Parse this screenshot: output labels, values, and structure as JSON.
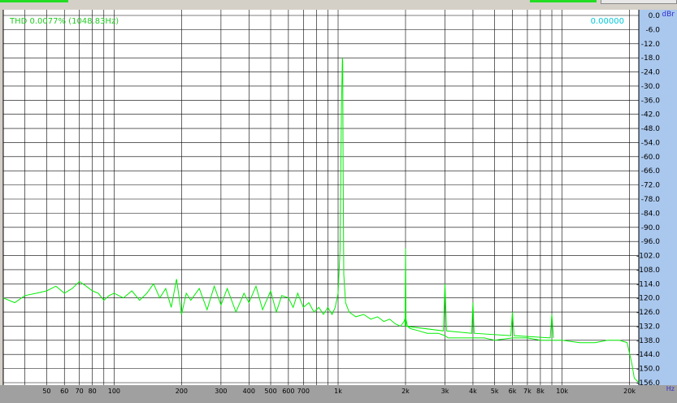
{
  "header": {
    "thd_label": "THD 0.0077% (1048.83Hz)",
    "value_readout": "0.00000",
    "unit_db": "dBr",
    "unit_hz": "Hz"
  },
  "colors": {
    "plot_bg": "#ffffff",
    "grid": "#000000",
    "trace": "#00ee00",
    "thd_text": "#22cc22",
    "readout_text": "#00c8d8",
    "y_axis_bg": "#aac8ee",
    "x_axis_bg": "#a0a0a0",
    "unit_text": "#3030d0"
  },
  "chart_data": {
    "type": "line",
    "xscale": "log",
    "xlim": [
      32,
      22000
    ],
    "ylim": [
      -156,
      0
    ],
    "x_tick_labels": [
      {
        "v": 50,
        "t": "50"
      },
      {
        "v": 60,
        "t": "60"
      },
      {
        "v": 70,
        "t": "70"
      },
      {
        "v": 80,
        "t": "80"
      },
      {
        "v": 100,
        "t": "100"
      },
      {
        "v": 200,
        "t": "200"
      },
      {
        "v": 300,
        "t": "300"
      },
      {
        "v": 400,
        "t": "400"
      },
      {
        "v": 500,
        "t": "500"
      },
      {
        "v": 600,
        "t": "600"
      },
      {
        "v": 700,
        "t": "700"
      },
      {
        "v": 1000,
        "t": "1k"
      },
      {
        "v": 2000,
        "t": "2k"
      },
      {
        "v": 3000,
        "t": "3k"
      },
      {
        "v": 4000,
        "t": "4k"
      },
      {
        "v": 5000,
        "t": "5k"
      },
      {
        "v": 6000,
        "t": "6k"
      },
      {
        "v": 7000,
        "t": "7k"
      },
      {
        "v": 8000,
        "t": "8k"
      },
      {
        "v": 10000,
        "t": "10k"
      },
      {
        "v": 20000,
        "t": "20k"
      }
    ],
    "x_grid": [
      40,
      50,
      60,
      70,
      80,
      90,
      100,
      200,
      300,
      400,
      500,
      600,
      700,
      800,
      900,
      1000,
      2000,
      3000,
      4000,
      5000,
      6000,
      7000,
      8000,
      9000,
      10000,
      20000
    ],
    "y_tick_labels": [
      "0.0",
      "-6.0",
      "-12.0",
      "-18.0",
      "-24.0",
      "-30.0",
      "-36.0",
      "-42.0",
      "-48.0",
      "-54.0",
      "-60.0",
      "-66.0",
      "-72.0",
      "-78.0",
      "-84.0",
      "-90.0",
      "-96.0",
      "-102.0",
      "-108.0",
      "-114.0",
      "-120.0",
      "-126.0",
      "-132.0",
      "-138.0",
      "-144.0",
      "-150.0",
      "-156.0"
    ],
    "series": [
      {
        "x": [
          32,
          36,
          40,
          45,
          50,
          55,
          60,
          65,
          70,
          75,
          80,
          85,
          90,
          95,
          100,
          110,
          120,
          130,
          140,
          150,
          160,
          170,
          180,
          190,
          200,
          210,
          220,
          240,
          260,
          280,
          300,
          320,
          350,
          380,
          400,
          430,
          460,
          500,
          530,
          560,
          600,
          630,
          660,
          700,
          740,
          780,
          820,
          860,
          900,
          940,
          970,
          1000,
          1020,
          1035,
          1045,
          1049,
          1052,
          1060,
          1080,
          1120,
          1200,
          1300,
          1400,
          1500,
          1600,
          1700,
          1800,
          1900,
          1970,
          2000,
          2040,
          2100,
          2300,
          2500,
          2800,
          3000,
          3100,
          3300,
          3600,
          4000,
          4500,
          5000,
          6000,
          7000,
          8000,
          9000,
          10000,
          12000,
          14000,
          16000,
          18000,
          19500,
          20500,
          21000,
          22000
        ],
        "y": [
          -120,
          -122,
          -119,
          -118,
          -117,
          -115,
          -118,
          -116,
          -113,
          -115,
          -117,
          -118,
          -121,
          -119,
          -118,
          -120,
          -117,
          -121,
          -118,
          -114,
          -120,
          -116,
          -124,
          -112,
          -127,
          -118,
          -121,
          -116,
          -125,
          -115,
          -123,
          -116,
          -126,
          -118,
          -122,
          -115,
          -125,
          -117,
          -126,
          -119,
          -120,
          -124,
          -118,
          -124,
          -122,
          -126,
          -124,
          -127,
          -124,
          -127,
          -124,
          -118,
          -100,
          -40,
          -18,
          -20,
          -60,
          -110,
          -122,
          -126,
          -128,
          -127,
          -129,
          -128,
          -130,
          -129,
          -131,
          -132,
          -130,
          -128,
          -132,
          -133,
          -134,
          -135,
          -135,
          -136,
          -137,
          -137,
          -137,
          -137,
          -137,
          -138,
          -137,
          -137,
          -138,
          -138,
          -138,
          -139,
          -139,
          -138,
          -138,
          -139,
          -148,
          -154,
          -156
        ]
      },
      {
        "x": [
          1990,
          2000,
          2010,
          2950,
          3000,
          3050,
          3950,
          4000,
          4050,
          5900,
          6000,
          6100,
          8850,
          9000,
          9150
        ],
        "y": [
          -132,
          -99,
          -132,
          -134,
          -114,
          -134,
          -135,
          -122,
          -135,
          -136,
          -126,
          -136,
          -137,
          -127,
          -137
        ]
      }
    ]
  }
}
